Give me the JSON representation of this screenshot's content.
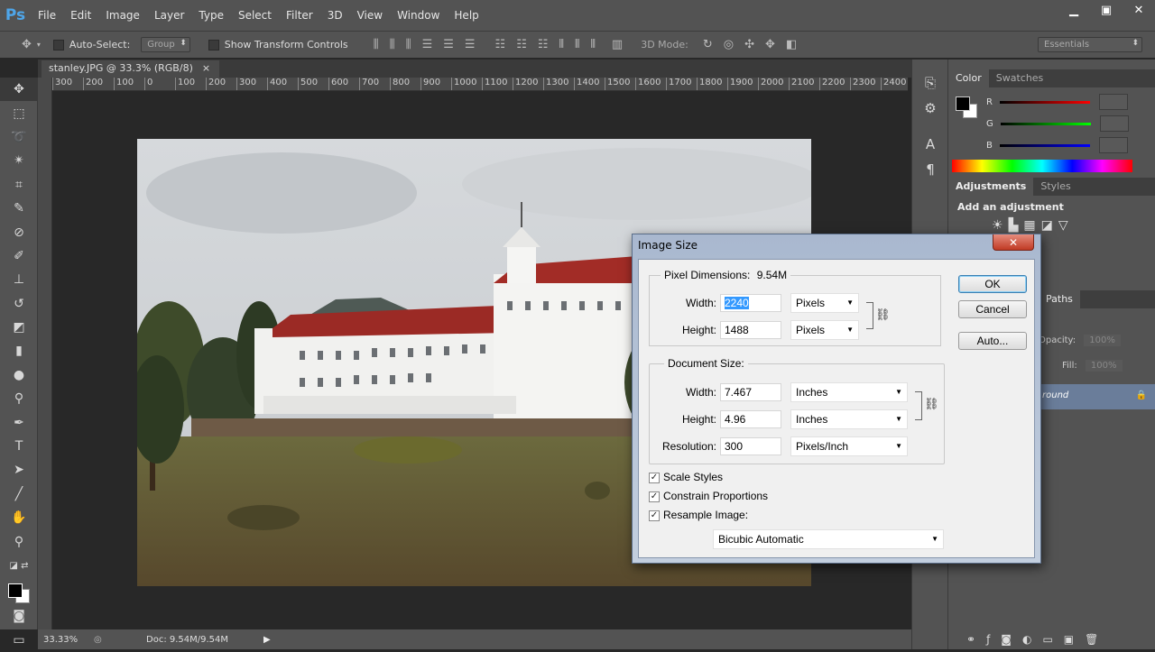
{
  "menubar": {
    "logo": "Ps",
    "items": [
      "File",
      "Edit",
      "Image",
      "Layer",
      "Type",
      "Select",
      "Filter",
      "3D",
      "View",
      "Window",
      "Help"
    ],
    "window_controls": [
      "▁",
      "▣",
      "✕"
    ]
  },
  "options": {
    "auto_select_label": "Auto-Select:",
    "auto_select_target": "Group",
    "show_transform_label": "Show Transform Controls",
    "mode_3d_label": "3D Mode:",
    "workspace": "Essentials"
  },
  "document": {
    "tab_title": "stanley.JPG @ 33.3% (RGB/8)",
    "tab_close": "×",
    "ruler_ticks": [
      "300",
      "200",
      "100",
      "0",
      "100",
      "200",
      "300",
      "400",
      "500",
      "600",
      "700",
      "800",
      "900",
      "1000",
      "1100",
      "1200",
      "1300",
      "1400",
      "1500",
      "1600",
      "1700",
      "1800",
      "1900",
      "2000",
      "2100",
      "2200",
      "2300",
      "2400"
    ]
  },
  "status": {
    "zoom": "33.33%",
    "doc_size": "Doc: 9.54M/9.54M"
  },
  "panels": {
    "color_tabs": [
      "Color",
      "Swatches"
    ],
    "color_channels": [
      "R",
      "G",
      "B"
    ],
    "adjust_tabs": [
      "Adjustments",
      "Styles"
    ],
    "adjust_heading": "Add an adjustment",
    "paths_tab": "Paths",
    "opacity_label": "Opacity:",
    "opacity_value": "100%",
    "fill_label": "Fill:",
    "fill_value": "100%",
    "layer_name": "round"
  },
  "dialog": {
    "title": "Image Size",
    "close": "✕",
    "pixel_dimensions_label": "Pixel Dimensions:",
    "pixel_dimensions_value": "9.54M",
    "pixel": {
      "width_label": "Width:",
      "width_value": "2240",
      "width_unit": "Pixels",
      "height_label": "Height:",
      "height_value": "1488",
      "height_unit": "Pixels"
    },
    "document_size_label": "Document Size:",
    "docsize": {
      "width_label": "Width:",
      "width_value": "7.467",
      "width_unit": "Inches",
      "height_label": "Height:",
      "height_value": "4.96",
      "height_unit": "Inches",
      "resolution_label": "Resolution:",
      "resolution_value": "300",
      "resolution_unit": "Pixels/Inch"
    },
    "checkboxes": [
      {
        "label": "Scale Styles",
        "checked": true
      },
      {
        "label": "Constrain Proportions",
        "checked": true
      },
      {
        "label": "Resample Image:",
        "checked": true
      }
    ],
    "resample_method": "Bicubic Automatic",
    "buttons": {
      "ok": "OK",
      "cancel": "Cancel",
      "auto": "Auto..."
    }
  }
}
